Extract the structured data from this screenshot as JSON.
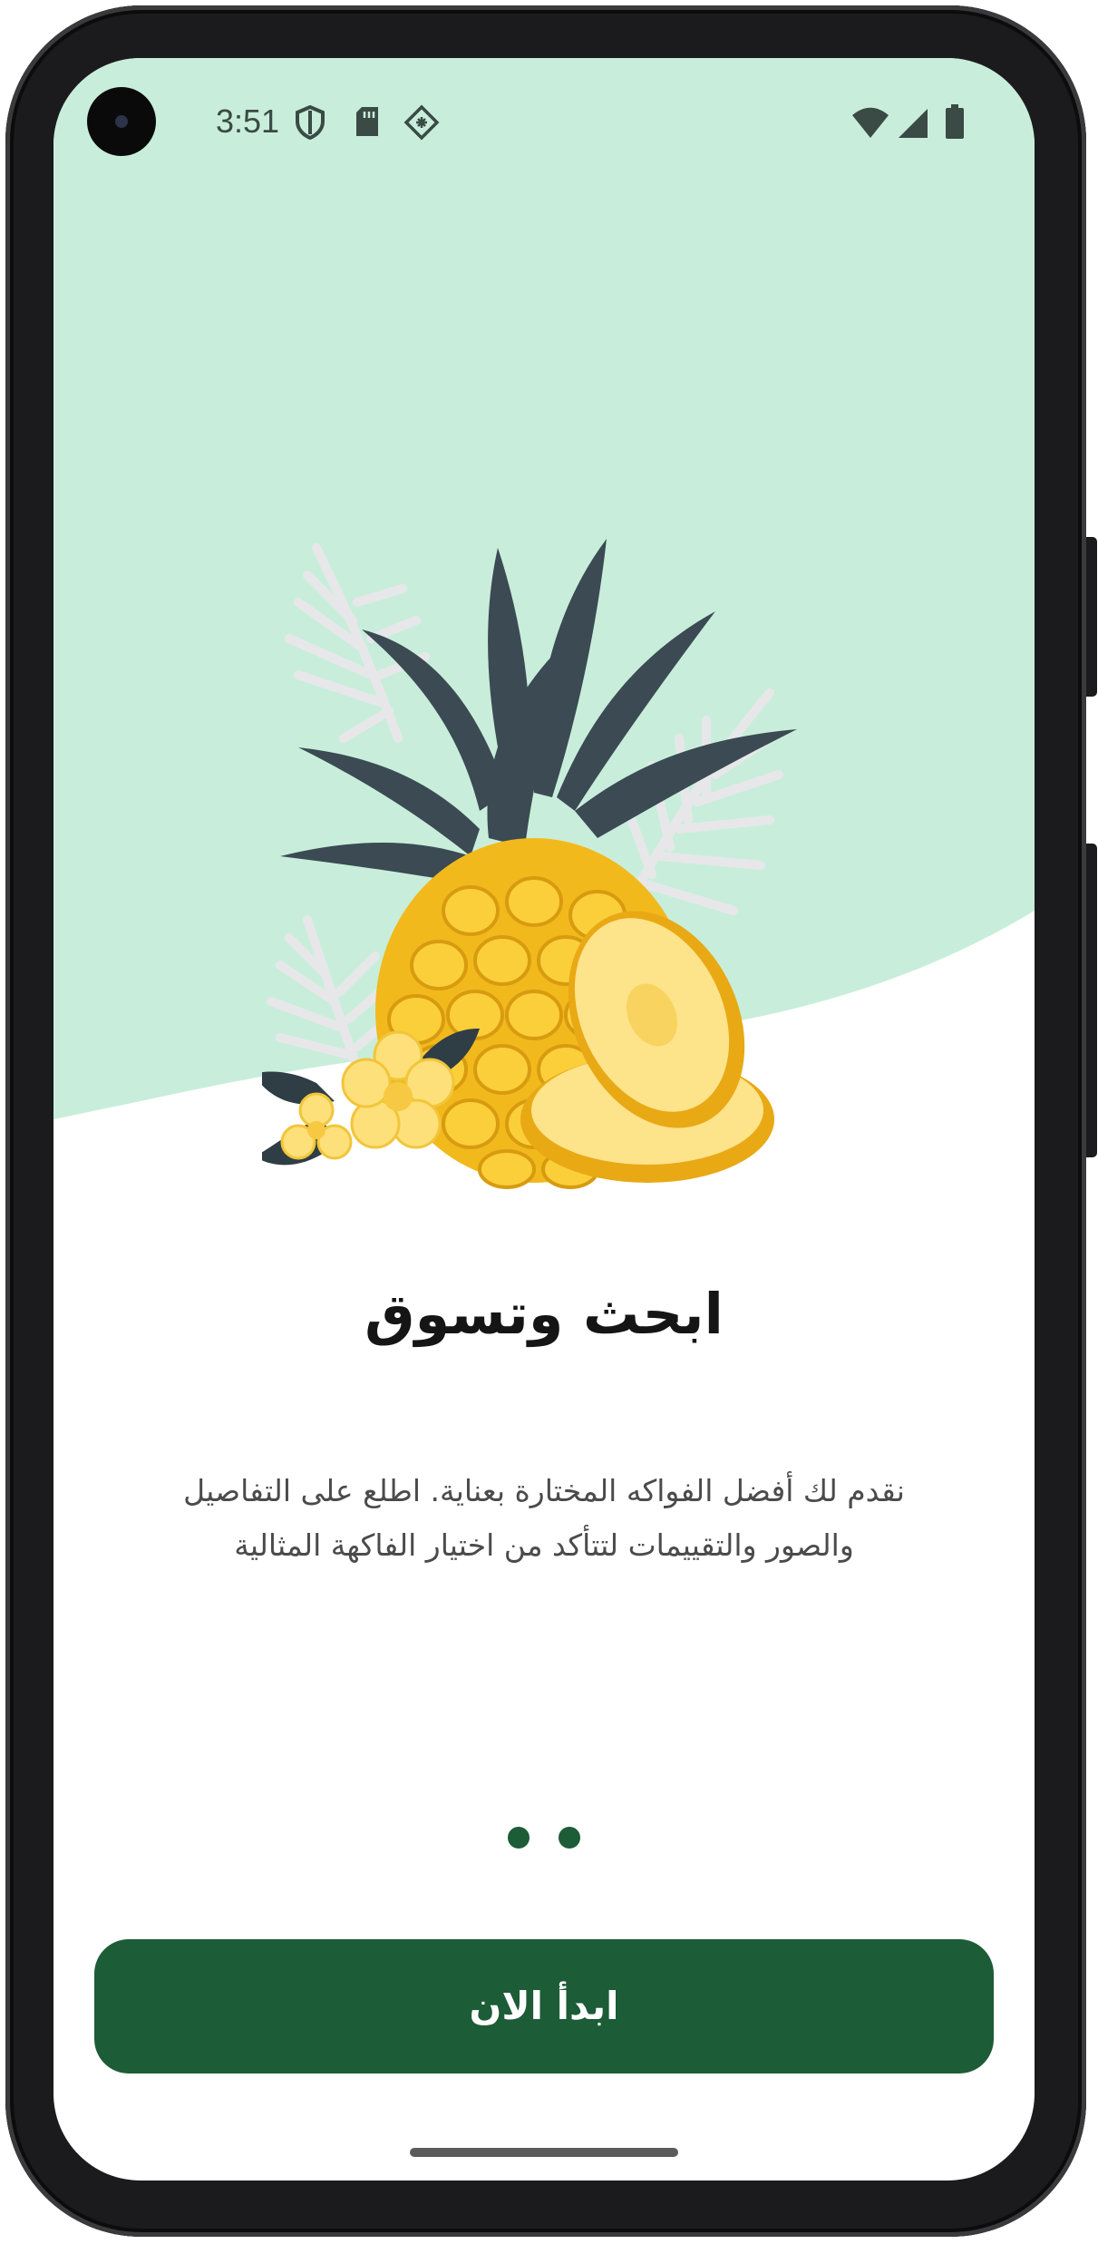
{
  "status_bar": {
    "time": "3:51",
    "left_icons": [
      "shield-icon",
      "sd-card-icon",
      "app-notification-icon"
    ],
    "right_icons": [
      "wifi-icon",
      "cellular-signal-icon",
      "battery-icon"
    ]
  },
  "hero": {
    "background_color": "#c8eedb",
    "illustration": "pineapple-icon"
  },
  "onboarding": {
    "title": "ابحث وتسوق",
    "description_line_1": "نقدم لك أفضل الفواكه المختارة بعناية. اطلع على التفاصيل",
    "description_line_2": "والصور والتقييمات لتتأكد من اختيار الفاكهة المثالية",
    "page_dots": 2,
    "start_button_label": "ابدأ الان"
  },
  "colors": {
    "accent": "#1c5c37",
    "hero": "#c8eedb",
    "title": "#151515",
    "text": "#4b4b4b"
  }
}
